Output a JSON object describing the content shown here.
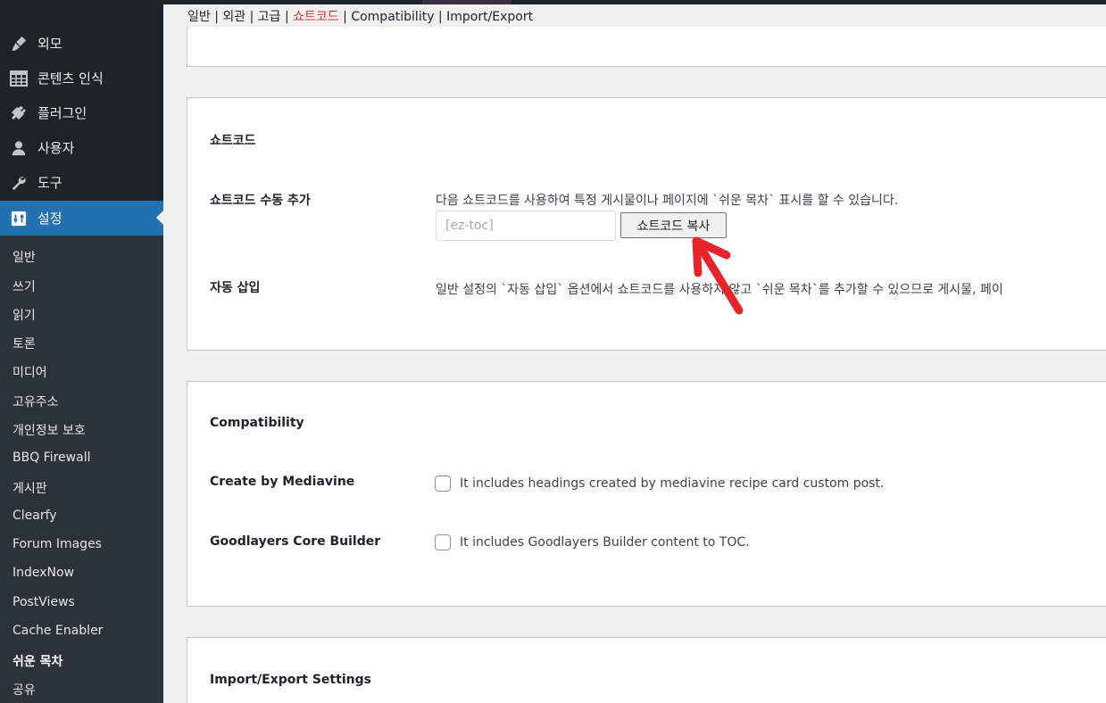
{
  "sidebar": {
    "menu": [
      {
        "label": "외모",
        "icon": "paintbrush-icon"
      },
      {
        "label": "콘텐츠 인식",
        "icon": "table-icon"
      },
      {
        "label": "플러그인",
        "icon": "plugin-icon"
      },
      {
        "label": "사용자",
        "icon": "user-icon"
      },
      {
        "label": "도구",
        "icon": "wrench-icon"
      },
      {
        "label": "설정",
        "icon": "settings-icon",
        "active": true
      }
    ],
    "submenu": [
      "일반",
      "쓰기",
      "읽기",
      "토론",
      "미디어",
      "고유주소",
      "개인정보 보호",
      "BBQ Firewall",
      "게시판",
      "Clearfy",
      "Forum Images",
      "IndexNow",
      "PostViews",
      "Cache Enabler",
      "쉬운 목차",
      "공유"
    ],
    "current_submenu": "쉬운 목차"
  },
  "tabs": [
    "일반",
    "외관",
    "고급",
    "쇼트코드",
    "Compatibility",
    "Import/Export"
  ],
  "current_tab": "쇼트코드",
  "tab_separator": " | ",
  "shortcode_section": {
    "title": "쇼트코드",
    "manual_label": "쇼트코드 수동 추가",
    "manual_desc": "다음 쇼트코드를 사용하여 특정 게시물이나 페이지에 `쉬운 목차` 표시를 할 수 있습니다.",
    "input_placeholder": "[ez-toc]",
    "copy_button": "쇼트코드 복사",
    "auto_label": "자동 삽입",
    "auto_desc": "일반 설정의 `자동 삽입` 옵션에서 쇼트코드를 사용하지 않고 `쉬운 목차`를 추가할 수 있으므로 게시물, 페이"
  },
  "compat_section": {
    "title": "Compatibility",
    "rows": [
      {
        "label": "Create by Mediavine",
        "desc": "It includes headings created by mediavine recipe card custom post."
      },
      {
        "label": "Goodlayers Core Builder",
        "desc": "It includes Goodlayers Builder content to TOC."
      }
    ]
  },
  "import_section": {
    "title": "Import/Export Settings"
  },
  "colors": {
    "sidebar_bg": "#1d2327",
    "submenu_bg": "#2c3338",
    "active_blue": "#2271b1",
    "current_tab": "#d63638",
    "annotation_arrow": "#e8232a"
  }
}
